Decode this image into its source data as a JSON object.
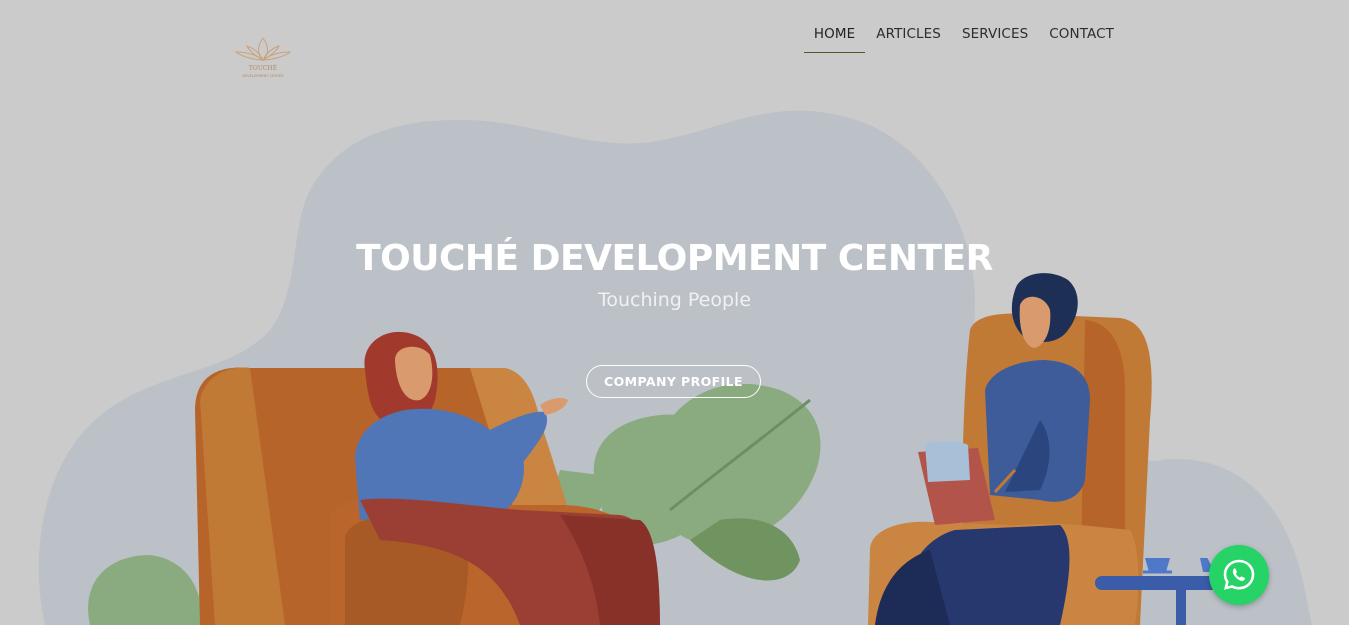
{
  "brand": {
    "logo_icon": "lotus-logo",
    "logo_text": "TOUCHÉ",
    "logo_subtext": "DEVELOPMENT CENTER"
  },
  "nav": {
    "items": [
      {
        "label": "HOME",
        "active": true
      },
      {
        "label": "ARTICLES",
        "active": false
      },
      {
        "label": "SERVICES",
        "active": false
      },
      {
        "label": "CONTACT",
        "active": false
      }
    ]
  },
  "hero": {
    "title": "TOUCHÉ DEVELOPMENT CENTER",
    "subtitle": "Touching People",
    "cta_label": "COMPANY PROFILE"
  },
  "floating": {
    "whatsapp_icon": "whatsapp-icon"
  },
  "colors": {
    "background": "#cbcbcb",
    "blob": "#bcc1c8",
    "accent_orange": "#c17a35",
    "whatsapp": "#25d366"
  }
}
